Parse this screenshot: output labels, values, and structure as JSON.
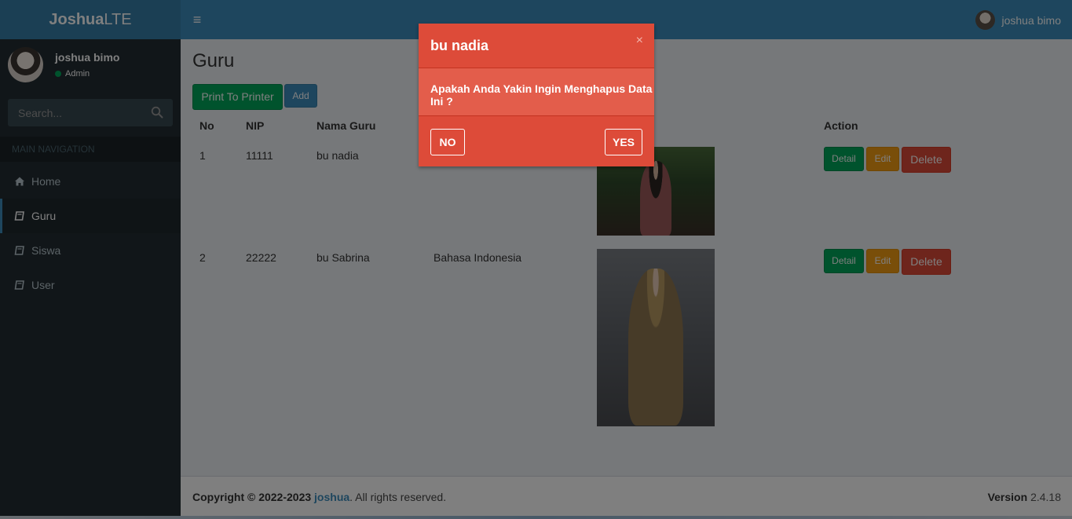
{
  "app": {
    "brand_bold": "Joshua",
    "brand_light": "LTE"
  },
  "header": {
    "user_name": "joshua bimo",
    "menu_icon": "hamburger-icon"
  },
  "sidebar": {
    "user_name": "joshua bimo",
    "user_role": "Admin",
    "search_placeholder": "Search...",
    "section_label": "MAIN NAVIGATION",
    "items": [
      {
        "label": "Home",
        "icon": "home-icon",
        "active": false
      },
      {
        "label": "Guru",
        "icon": "book-icon",
        "active": true
      },
      {
        "label": "Siswa",
        "icon": "book-icon",
        "active": false
      },
      {
        "label": "User",
        "icon": "book-icon",
        "active": false
      }
    ]
  },
  "main": {
    "title": "Guru",
    "print_label": "Print To Printer",
    "add_label": "Add",
    "columns": [
      "No",
      "NIP",
      "Nama Guru",
      "Action"
    ],
    "rows": [
      {
        "no": "1",
        "nip": "11111",
        "name": "bu nadia",
        "subject": ""
      },
      {
        "no": "2",
        "nip": "22222",
        "name": "bu Sabrina",
        "subject": "Bahasa Indonesia"
      }
    ],
    "actions": {
      "detail": "Detail",
      "edit": "Edit",
      "delete": "Delete"
    }
  },
  "modal": {
    "title": "bu nadia",
    "close": "×",
    "message": "Apakah Anda Yakin Ingin Menghapus Data Ini ?",
    "no_label": "NO",
    "yes_label": "YES"
  },
  "footer": {
    "copyright_prefix": "Copyright © 2022-2023 ",
    "link_text": "joshua",
    "suffix": ". All rights reserved.",
    "version_label": "Version",
    "version_value": "2.4.18"
  },
  "colors": {
    "primary": "#3c8dbc",
    "success": "#00a65a",
    "warning": "#f39c12",
    "danger": "#dd4b39",
    "sidebar": "#222d32"
  }
}
